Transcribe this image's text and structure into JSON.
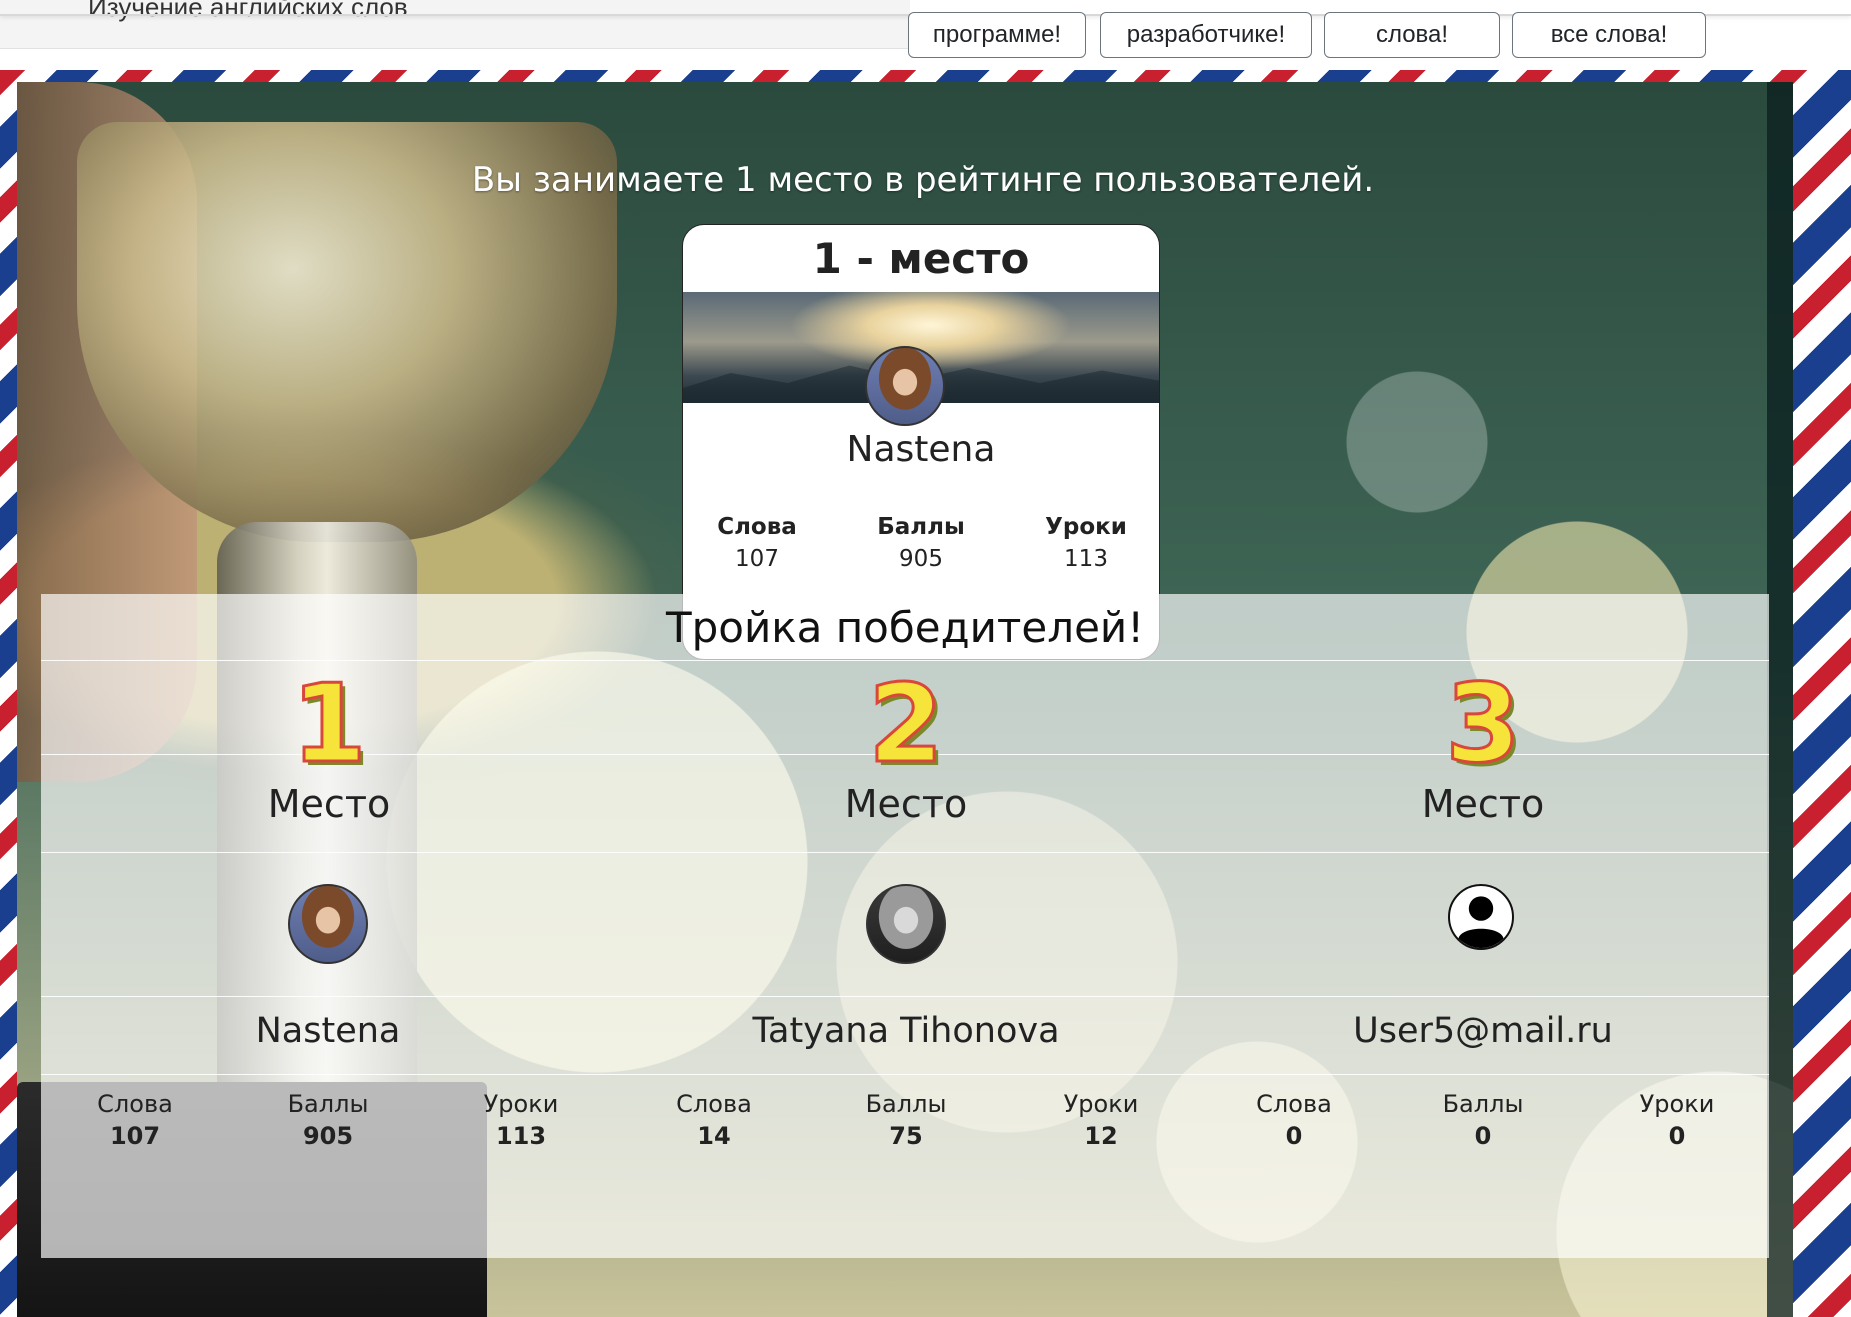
{
  "header": {
    "brand": "Изучение английских слов",
    "nav_buttons": [
      "программе!",
      "разработчике!",
      "слова!",
      "все слова!"
    ]
  },
  "rating": {
    "message": "Вы занимаете 1 место в рейтинге пользователей."
  },
  "profile_card": {
    "place": "1 - место",
    "name": "Nastena",
    "stats": [
      {
        "label": "Слова",
        "value": "107"
      },
      {
        "label": "Баллы",
        "value": "905"
      },
      {
        "label": "Уроки",
        "value": "113"
      }
    ]
  },
  "winners": {
    "title": "Тройка победителей!",
    "place_word": "Место",
    "entries": [
      {
        "number": "1",
        "name": "Nastena",
        "avatar": "user-photo",
        "stats": [
          {
            "label": "Слова",
            "value": "107"
          },
          {
            "label": "Баллы",
            "value": "905"
          },
          {
            "label": "Уроки",
            "value": "113"
          }
        ]
      },
      {
        "number": "2",
        "name": "Tatyana Tihonova",
        "avatar": "user-photo",
        "stats": [
          {
            "label": "Слова",
            "value": "14"
          },
          {
            "label": "Баллы",
            "value": "75"
          },
          {
            "label": "Уроки",
            "value": "12"
          }
        ]
      },
      {
        "number": "3",
        "name": "User5@mail.ru",
        "avatar": "default-user-icon",
        "stats": [
          {
            "label": "Слова",
            "value": "0"
          },
          {
            "label": "Баллы",
            "value": "0"
          },
          {
            "label": "Уроки",
            "value": "0"
          }
        ]
      }
    ]
  }
}
